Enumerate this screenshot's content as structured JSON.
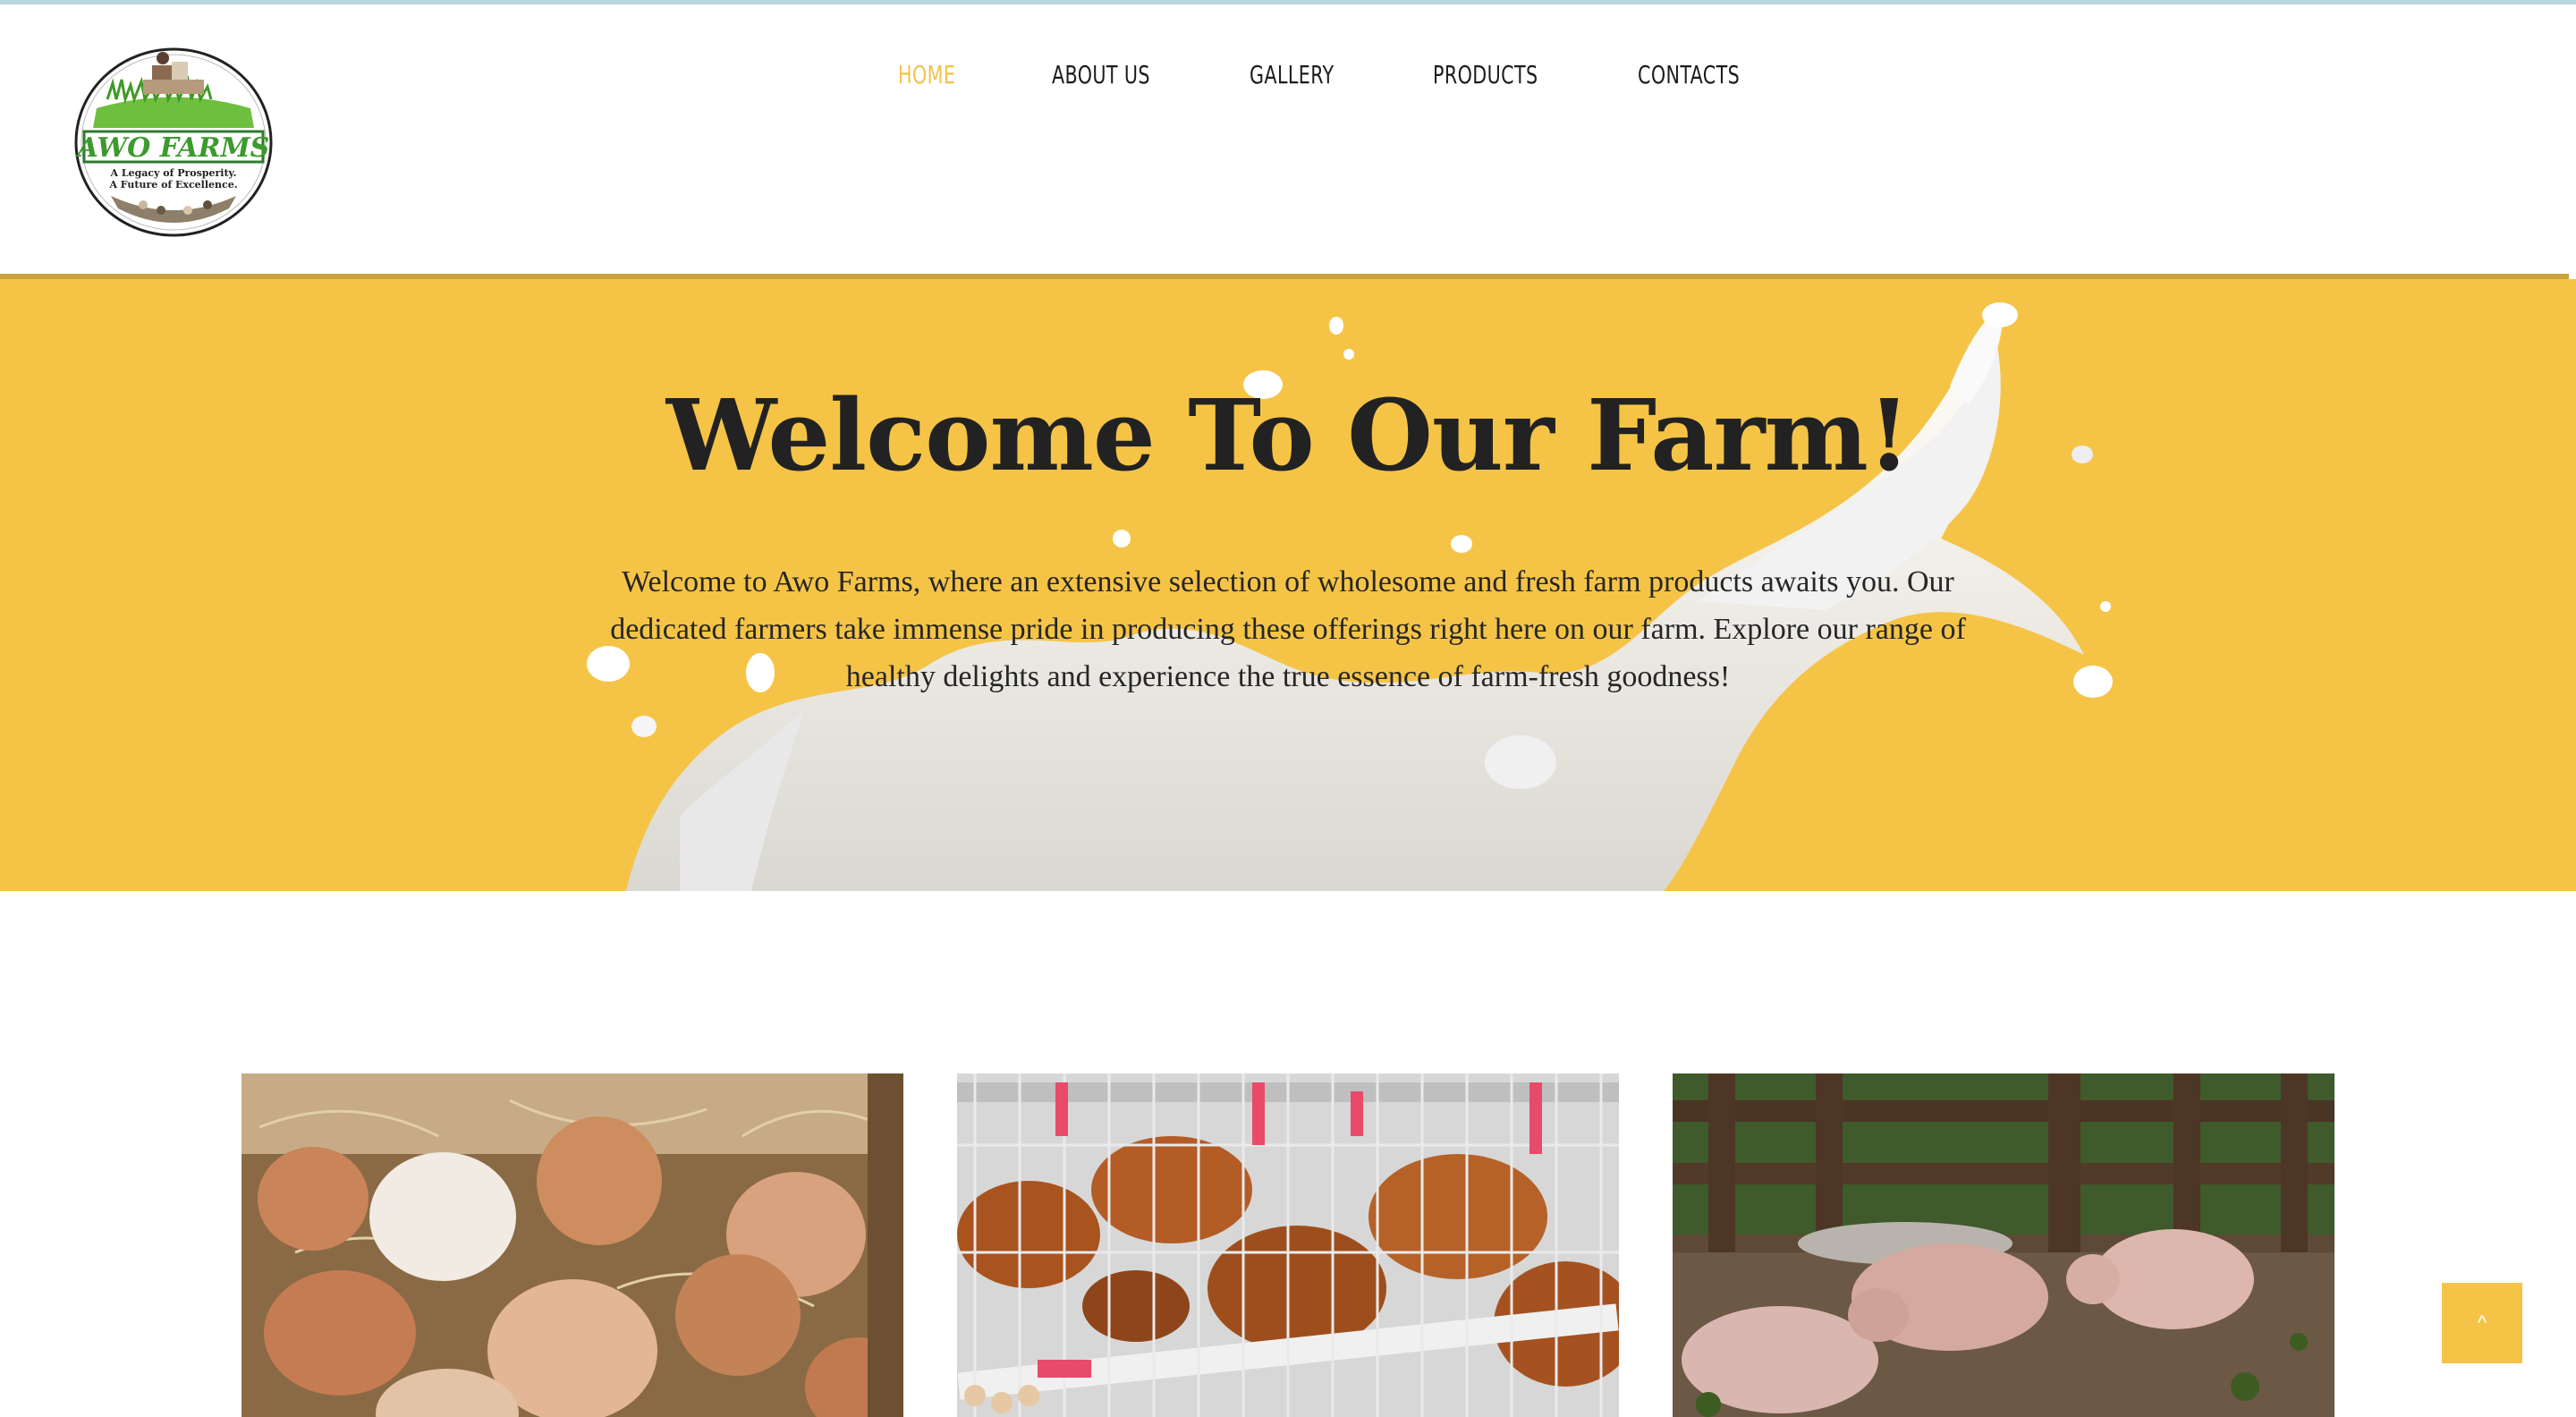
{
  "logo": {
    "name": "AWO FARMS",
    "tagline_line1": "A Legacy of Prosperity.",
    "tagline_line2": "A Future of Excellence."
  },
  "nav": {
    "items": [
      {
        "label": "HOME",
        "active": true
      },
      {
        "label": "ABOUT US",
        "active": false
      },
      {
        "label": "GALLERY",
        "active": false
      },
      {
        "label": "PRODUCTS",
        "active": false
      },
      {
        "label": "CONTACTS",
        "active": false
      }
    ]
  },
  "hero": {
    "title": "Welcome To Our Farm!",
    "text": "Welcome to Awo Farms, where an extensive selection of wholesome and fresh farm products awaits you. Our dedicated farmers take immense pride in producing these offerings right here on our farm. Explore our range of healthy delights and experience the true essence of farm-fresh goodness!",
    "background_color": "#f5c447"
  },
  "cards": [
    {
      "subject": "eggs-in-straw"
    },
    {
      "subject": "hens-in-cages"
    },
    {
      "subject": "piglets-in-yard"
    }
  ],
  "back_to_top": {
    "icon": "chevron-up-icon",
    "glyph": "^"
  },
  "colors": {
    "accent": "#f5c447",
    "active_nav": "#f1c24a",
    "text": "#222222",
    "header_border": "#c9a43c"
  }
}
